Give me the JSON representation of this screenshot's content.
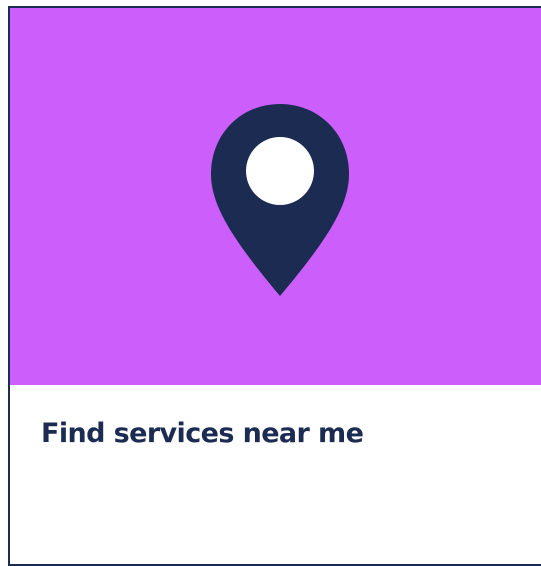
{
  "card": {
    "title": "Find services near me",
    "icon": "location-pin-icon",
    "hero_color": "#cc5ffc",
    "icon_color": "#1b2b52",
    "text_color": "#1b2b52"
  }
}
